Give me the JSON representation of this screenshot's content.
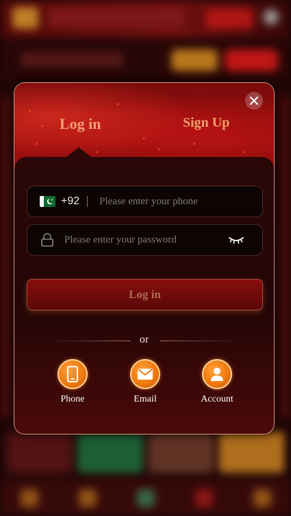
{
  "modal": {
    "tabs": {
      "login": "Log in",
      "signup": "Sign Up"
    },
    "phone": {
      "country_code": "+92",
      "placeholder": "Please enter your phone"
    },
    "password": {
      "placeholder": "Please enter your password"
    },
    "login_button": "Log in",
    "divider_text": "or",
    "alternatives": [
      {
        "label": "Phone",
        "icon": "phone-icon"
      },
      {
        "label": "Email",
        "icon": "email-icon"
      },
      {
        "label": "Account",
        "icon": "user-icon"
      }
    ]
  },
  "colors": {
    "accent_orange": "#f07a10",
    "tab_text": "#f2a074",
    "modal_red": "#a01010"
  }
}
